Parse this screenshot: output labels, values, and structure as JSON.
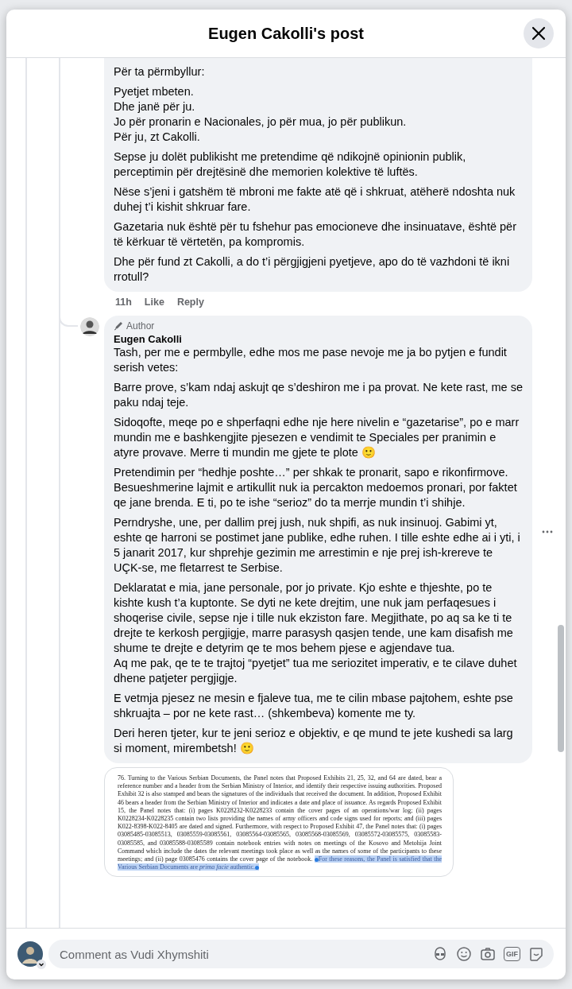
{
  "header": {
    "title": "Eugen Cakolli's post"
  },
  "comments": [
    {
      "paragraphs": [
        {
          "text": "Për ta përmbyllur:"
        },
        {
          "text": "Pyetjet mbeten.\nDhe janë për ju.\nJo për pronarin e Nacionales, jo për mua, jo për publikun.\nPër ju, zt Cakolli."
        },
        {
          "text": "Sepse ju dolët publikisht me pretendime që ndikojnë opinionin publik, perceptimin për drejtësinë dhe memorien kolektive të luftës."
        },
        {
          "text": "Nëse s’jeni i gatshëm të mbroni me fakte atë që i shkruat, atëherë ndoshta nuk duhej t’i kishit shkruar fare."
        },
        {
          "text": "Gazetaria nuk është për tu fshehur pas emocioneve dhe insinuatave, është për të kërkuar të vërtetën, pa kompromis."
        },
        {
          "text": "Dhe për fund zt Cakolli, a do t’i përgjigjeni pyetjeve, apo do të vazhdoni të ikni rrotull?"
        }
      ],
      "time": "11h",
      "actions": [
        "Like",
        "Reply"
      ]
    },
    {
      "badge": "Author",
      "author": "Eugen Cakolli",
      "paragraphs": [
        {
          "text": "Tash, per me e permbylle, edhe mos me pase nevoje me ja bo pytjen e fundit serish vetes:"
        },
        {
          "text": "Barre prove, s’kam ndaj askujt qe s’deshiron me i pa provat. Ne kete rast, me se paku ndaj teje."
        },
        {
          "text": "Sidoqofte, meqe po e shperfaqni edhe nje here nivelin e “gazetarise”, po e marr mundin me e bashkengjite pjesezen e vendimit te Speciales per pranimin e atyre provave. Merre ti mundin me gjete te plote 🙂"
        },
        {
          "text": "Pretendimin per “hedhje poshte…” per shkak te pronarit, sapo e rikonfirmove. Besueshmerine lajmit e artikullit nuk ia percakton medoemos pronari, por faktet qe jane brenda. E ti, po te ishe “serioz” do ta merrje mundin t’i shihje."
        },
        {
          "text": "Perndryshe, une, per dallim prej jush, nuk shpifi, as nuk insinuoj. Gabimi yt, eshte qe harroni se postimet jane publike, edhe ruhen. I tille eshte edhe ai i yti, i 5 janarit 2017, kur shprehje gezimin me arrestimin e nje prej ish-krereve te UÇK-se, me fletarrest te Serbise."
        },
        {
          "text": "Deklaratat e mia, jane personale, por jo private. Kjo eshte e thjeshte, po te kishte kush t’a kuptonte. Se dyti ne kete drejtim, une nuk jam perfaqesues i shoqerise civile, sepse nje i tille nuk ekziston fare. Megjithate, po aq sa ke ti te drejte te kerkosh pergjigje, marre parasysh qasjen tende, une kam disafish me shume te drejte e detyrim qe te mos behem pjese e agjendave tua.\nAq me pak, qe te te trajtoj “pyetjet” tua me seriozitet imperativ, e te cilave duhet dhene patjeter pergjigje."
        },
        {
          "text": "E vetmja pjesez ne mesin e fjaleve tua, me te cilin mbase pajtohem, eshte pse shkruajta – por ne kete rast… (shkembeva) komente me ty."
        },
        {
          "text": "Deri heren tjeter, kur te jeni serioz e objektiv, e qe mund te jete kushedi sa larg si moment, mirembetsh! 🙂"
        }
      ],
      "attachment": {
        "kind": "document",
        "text": "76. Turning to the Various Serbian Documents, the Panel notes that Proposed Exhibits 21, 25, 32, and 64 are dated, bear a reference number and a header from the Serbian Ministry of Interior, and identify their respective issuing authorities. Proposed Exhibit 32 is also stamped and bears the signatures of the individuals that received the document. In addition, Proposed Exhibit 46 bears a header from the Serbian Ministry of Interior and indicates a date and place of issuance. As regards Proposed Exhibit 15, the Panel notes that: (i) pages K0228232-K0228233 contain the cover pages of an operations/war log; (ii) pages K0228234-K0228235 contain two lists providing the names of army officers and code signs used for reports; and (iii) pages K022-8398-K022-8405 are dated and signed. Furthermore, with respect to Proposed Exhibit 47, the Panel notes that: (i) pages 03085485-03085513, 03085559-03085561, 03085564-03085565, 03085568-03085569, 03085572-03085575, 03085583-03085585, and 03085588-03085589 contain notebook entries with notes on meetings of the Kosovo and Metohija Joint Command which include the dates the relevant meetings took place as well as the names of some of the participants to these meetings; and (ii) page 03085476 contains the cover page of the notebook.",
        "highlighted": "For these reasons, the Panel is satisfied that the Various Serbian Documents are *prima facie* authentic."
      }
    }
  ],
  "composer": {
    "placeholder": "Comment as Vudi Xhymshiti",
    "gif_label": "GIF"
  }
}
